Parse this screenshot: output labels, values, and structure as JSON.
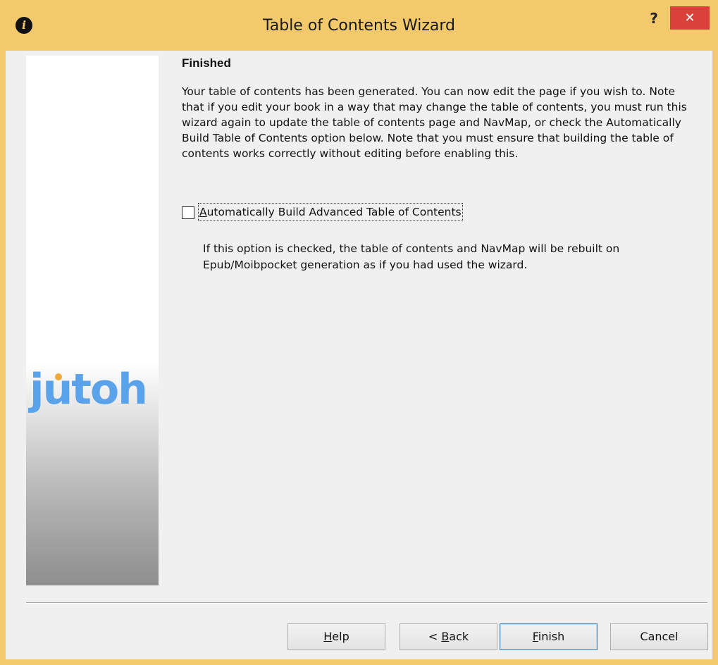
{
  "window": {
    "title": "Table of Contents Wizard",
    "help_glyph": "?",
    "close_glyph": "✕",
    "app_icon_glyph": "i"
  },
  "side_panel": {
    "logo_text": "jutoh"
  },
  "page": {
    "heading": "Finished",
    "body": "Your table of contents has been generated.  You can now edit the page if you wish to. Note that if you edit your book in a way that may change the table of contents, you must run this wizard again to update the table of contents page and NavMap, or check the Automatically Build Table of Contents option below. Note that you must ensure that building the table of contents works correctly without editing before enabling this.",
    "checkbox": {
      "label_access_key": "A",
      "label_rest": "utomatically Build Advanced Table of Contents",
      "checked": false
    },
    "hint": "If this option is checked, the table of contents and NavMap will be rebuilt on Epub/Moibpocket generation as if you had used the wizard."
  },
  "buttons": {
    "help": {
      "access_key": "H",
      "rest": "elp"
    },
    "back": {
      "prefix": "< ",
      "access_key": "B",
      "rest": "ack"
    },
    "finish": {
      "access_key": "F",
      "rest": "inish"
    },
    "cancel": {
      "label": "Cancel"
    }
  },
  "colors": {
    "titlebar": "#f2c96b",
    "close_button": "#d9413a",
    "logo": "#5aa3ea",
    "logo_accent": "#f2a93b",
    "default_button_border": "#3c7fb1"
  }
}
